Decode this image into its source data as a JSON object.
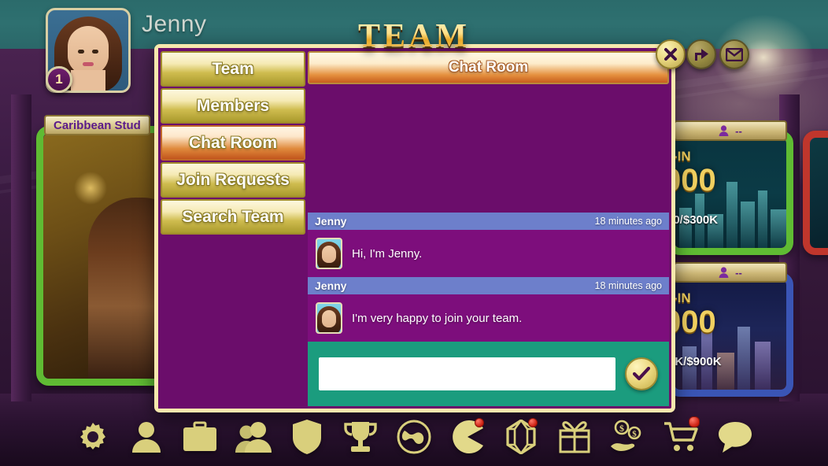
{
  "window": {
    "title": "TEAM"
  },
  "player": {
    "name": "Jenny",
    "level": "1",
    "avatar_icon": "player-portrait"
  },
  "top_buttons": [
    {
      "name": "close-button",
      "icon": "close-icon",
      "label": "Close"
    },
    {
      "name": "share-button",
      "icon": "share-icon",
      "label": "Share"
    },
    {
      "name": "mail-button",
      "icon": "mail-icon",
      "label": "Mail"
    }
  ],
  "panel": {
    "tabs": [
      {
        "label": "Team",
        "active": false
      },
      {
        "label": "Members",
        "active": false
      },
      {
        "label": "Chat Room",
        "active": true
      },
      {
        "label": "Join Requests",
        "active": false
      },
      {
        "label": "Search Team",
        "active": false
      }
    ],
    "content_header": "Chat Room",
    "messages": [
      {
        "author": "Jenny",
        "time": "18 minutes ago",
        "text": "Hi, I'm Jenny."
      },
      {
        "author": "Jenny",
        "time": "18 minutes ago",
        "text": "I'm very happy to join your team."
      }
    ],
    "input": {
      "value": "",
      "placeholder": ""
    },
    "send_icon": "checkmark-icon"
  },
  "lobby_cards": [
    {
      "name": "caribbean-stud-card",
      "label": "Caribbean Stud",
      "accent": "#5fbb33"
    },
    {
      "name": "city-table-card-top",
      "plate_text": "--",
      "buyin_label": "-IN",
      "amount": "000",
      "stakes": "00/$300K",
      "accent": "#5fbb33"
    },
    {
      "name": "city-table-card-bottom",
      "plate_text": "--",
      "buyin_label": "-IN",
      "amount": "000",
      "stakes": "5K/$900K",
      "accent": "#3a55b5"
    }
  ],
  "toolbar": [
    {
      "name": "settings",
      "icon": "gear-icon",
      "badge": false
    },
    {
      "name": "profile",
      "icon": "person-icon",
      "badge": false
    },
    {
      "name": "briefcase",
      "icon": "briefcase-icon",
      "badge": false
    },
    {
      "name": "friends",
      "icon": "people-icon",
      "badge": false
    },
    {
      "name": "shield",
      "icon": "shield-icon",
      "badge": false
    },
    {
      "name": "leaderboard",
      "icon": "trophy-icon",
      "badge": false
    },
    {
      "name": "world",
      "icon": "globe-icon",
      "badge": false
    },
    {
      "name": "games",
      "icon": "pacman-icon",
      "badge": true
    },
    {
      "name": "gems",
      "icon": "gem-icon",
      "badge": true
    },
    {
      "name": "gifts",
      "icon": "gift-icon",
      "badge": false
    },
    {
      "name": "bonus",
      "icon": "money-hand-icon",
      "badge": false
    },
    {
      "name": "shop",
      "icon": "cart-icon",
      "badge": true
    },
    {
      "name": "chat",
      "icon": "speech-bubble-icon",
      "badge": false
    }
  ],
  "colors": {
    "panel_border": "#f7e8ad",
    "panel_bg": "#6b0d6b",
    "tab_gold": "#cfbc4f",
    "tab_active_orange": "#e08a3c",
    "msg_header_blue": "#6d7fcb",
    "msg_body_purple": "#7d0e7c",
    "input_bar_teal": "#1b9c7e",
    "title_gold": "#ffd966",
    "top_teal": "#2e7070"
  }
}
